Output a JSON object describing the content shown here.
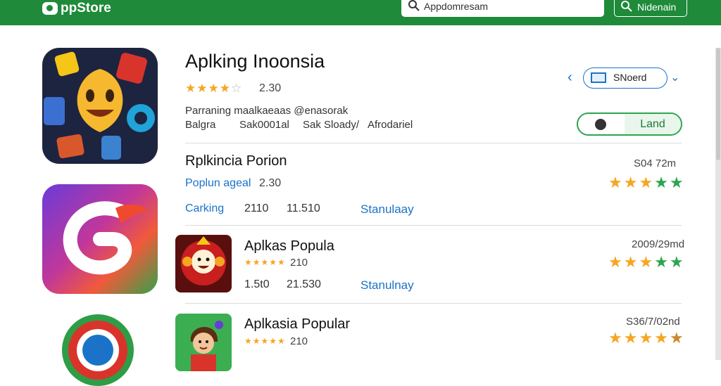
{
  "header": {
    "app_name": "ppStore",
    "search_value": "Appdomresam",
    "search_button_label": "Nidenain"
  },
  "featured": {
    "title": "Aplking Inoonsia",
    "rating_value": 4,
    "rating_text": "2.30",
    "meta_line": "Parraning maalkaeaas @enasorak",
    "meta_items": [
      "Balgra",
      "Sak0001al",
      "Sak Sloady/",
      "Afrodariel"
    ],
    "select_label": "SNoerd",
    "toggle_label": "Land"
  },
  "rows": [
    {
      "title": "Rplkincia Porion",
      "subtitle": "Poplun ageal",
      "rating_text": "2.30",
      "right_meta": "S04 72m",
      "col1": "Carking",
      "col2": "2110",
      "col3": "11.510",
      "link": "Stanulaay",
      "star_colors": [
        "#f5a623",
        "#f5a623",
        "#f5a623",
        "#2ea44f",
        "#2ea44f"
      ]
    },
    {
      "title": "Aplkas Popula",
      "rating_text": "210",
      "right_meta": "2009/29md",
      "col1": "1.5t0",
      "col2": "21.530",
      "link": "Stanulnay",
      "star_colors": [
        "#f5a623",
        "#f5a623",
        "#f5a623",
        "#2ea44f",
        "#2ea44f"
      ]
    },
    {
      "title": "Aplkasia Popular",
      "rating_text": "210",
      "right_meta": "S36/7/02nd",
      "star_colors": [
        "#f5a623",
        "#f5a623",
        "#f5a623",
        "#f5a623",
        "#c98a2b"
      ]
    }
  ],
  "icons": {
    "search": "search-icon",
    "chevron_left": "chevron-left-icon",
    "chevron_down": "chevron-down-icon"
  }
}
